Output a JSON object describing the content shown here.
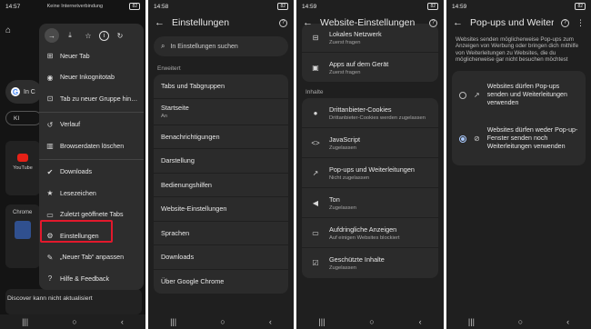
{
  "panel1": {
    "status_time": "14:57",
    "status_notice": "Keine Internetverbindung",
    "battery": "82",
    "menu_items": [
      {
        "icon": "new-tab-icon",
        "glyph": "⊞",
        "label": "Neuer Tab"
      },
      {
        "icon": "incognito-icon",
        "glyph": "◉",
        "label": "Neuer Inkognitotab"
      },
      {
        "icon": "tab-group-icon",
        "glyph": "⊡",
        "label": "Tab zu neuer Gruppe hin…"
      },
      {
        "icon": "history-icon",
        "glyph": "↺",
        "label": "Verlauf"
      },
      {
        "icon": "delete-icon",
        "glyph": "▥",
        "label": "Browserdaten löschen"
      },
      {
        "icon": "downloads-icon",
        "glyph": "✔",
        "label": "Downloads"
      },
      {
        "icon": "bookmarks-icon",
        "glyph": "★",
        "label": "Lesezeichen"
      },
      {
        "icon": "recent-tabs-icon",
        "glyph": "▭",
        "label": "Zuletzt geöffnete Tabs"
      },
      {
        "icon": "settings-icon",
        "glyph": "⚙",
        "label": "Einstellungen"
      },
      {
        "icon": "edit-icon",
        "glyph": "✎",
        "label": "„Neuer Tab“ anpassen"
      },
      {
        "icon": "help-icon",
        "glyph": "?",
        "label": "Hilfe & Feedback"
      }
    ],
    "bg_search_text": "In C",
    "bg_ki": "KI",
    "bg_youtube": "YouTube",
    "bg_chrome": "Chrome",
    "bg_discover": "Discover kann nicht aktualisiert"
  },
  "panel2": {
    "status_time": "14:58",
    "battery": "82",
    "title": "Einstellungen",
    "search_placeholder": "In Einstellungen suchen",
    "section": "Erweitert",
    "items": [
      {
        "label": "Tabs und Tabgruppen",
        "sub": ""
      },
      {
        "label": "Startseite",
        "sub": "An"
      },
      {
        "label": "Benachrichtigungen",
        "sub": ""
      },
      {
        "label": "Darstellung",
        "sub": ""
      },
      {
        "label": "Bedienungshilfen",
        "sub": ""
      },
      {
        "label": "Website-Einstellungen",
        "sub": ""
      },
      {
        "label": "Sprachen",
        "sub": ""
      },
      {
        "label": "Downloads",
        "sub": ""
      },
      {
        "label": "Über Google Chrome",
        "sub": ""
      }
    ]
  },
  "panel3": {
    "status_time": "14:59",
    "battery": "82",
    "title": "Website-Einstellungen",
    "top_items": [
      {
        "icon": "local-network-icon",
        "glyph": "⊟",
        "label": "Lokales Netzwerk",
        "sub": "Zuerst fragen"
      },
      {
        "icon": "apps-icon",
        "glyph": "▣",
        "label": "Apps auf dem Gerät",
        "sub": "Zuerst fragen"
      }
    ],
    "section": "Inhalte",
    "items": [
      {
        "icon": "cookie-icon",
        "glyph": "●",
        "label": "Drittanbieter-Cookies",
        "sub": "Drittanbieter-Cookies werden zugelassen"
      },
      {
        "icon": "javascript-icon",
        "glyph": "<>",
        "label": "JavaScript",
        "sub": "Zugelassen"
      },
      {
        "icon": "popup-icon",
        "glyph": "↗",
        "label": "Pop-ups und Weiterleitungen",
        "sub": "Nicht zugelassen"
      },
      {
        "icon": "sound-icon",
        "glyph": "◀",
        "label": "Ton",
        "sub": "Zugelassen"
      },
      {
        "icon": "intrusive-ads-icon",
        "glyph": "▭",
        "label": "Aufdringliche Anzeigen",
        "sub": "Auf einigen Websites blockiert"
      },
      {
        "icon": "protected-content-icon",
        "glyph": "☑",
        "label": "Geschützte Inhalte",
        "sub": "Zugelassen"
      }
    ]
  },
  "panel4": {
    "status_time": "14:59",
    "battery": "82",
    "title": "Pop-ups und Weiterle…",
    "description": "Websites senden möglicherweise Pop-ups zum Anzeigen von Werbung oder bringen dich mithilfe von Weiterleitungen zu Websites, die du möglicherweise gar nicht besuchen möchtest",
    "option_allow": "Websites dürfen Pop-ups senden und Weiterleitungen verwenden",
    "option_block": "Websites dürfen weder Pop-up-Fenster senden noch Weiterleitungen verwenden"
  },
  "nav": {
    "recents": "|||",
    "home": "○",
    "back": "‹"
  },
  "colors": {
    "highlight": "#e2192c",
    "card": "#2b2b2b",
    "bg": "#1f1f1f"
  }
}
